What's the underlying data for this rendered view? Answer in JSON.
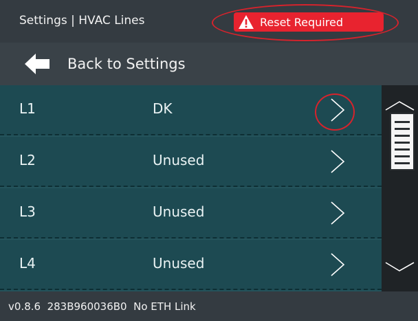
{
  "header": {
    "title": "Settings | HVAC Lines",
    "reset_badge": "Reset Required",
    "alert_color": "#e8232f",
    "warning_icon": "warning-triangle-icon"
  },
  "nav": {
    "back_label": "Back to Settings",
    "back_icon": "arrow-left-icon"
  },
  "lines": [
    {
      "line": "L1",
      "value": "DK"
    },
    {
      "line": "L2",
      "value": "Unused"
    },
    {
      "line": "L3",
      "value": "Unused"
    },
    {
      "line": "L4",
      "value": "Unused"
    }
  ],
  "footer": {
    "status": "v0.8.6  283B960036B0  No ETH Link"
  }
}
